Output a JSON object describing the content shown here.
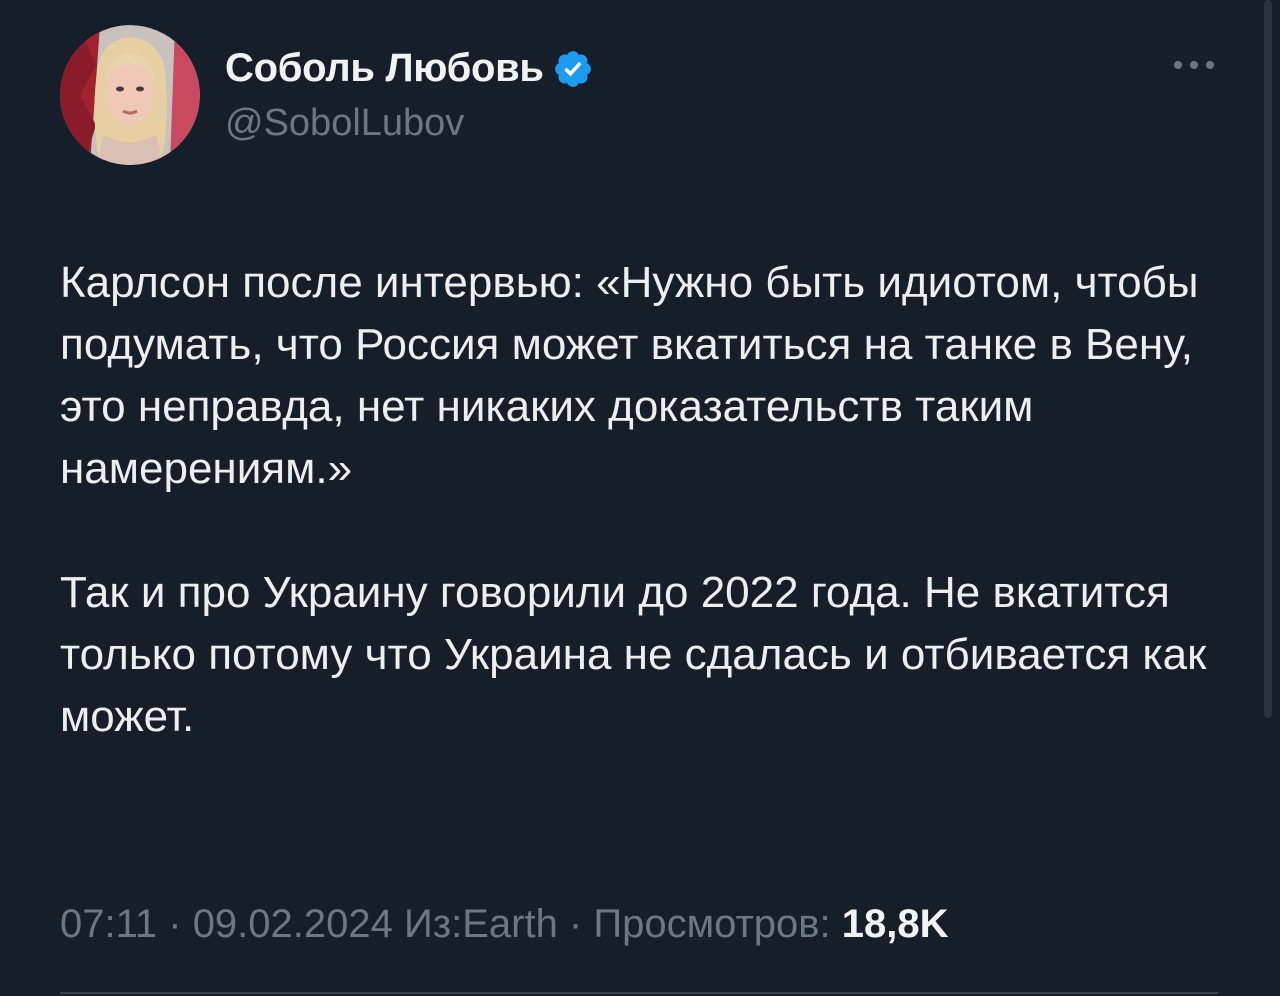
{
  "author": {
    "name": "Соболь Любовь",
    "handle": "@SobolLubov",
    "verified": true,
    "avatar_icon": "avatar-photo"
  },
  "tweet": {
    "paragraph1": "Карлсон после интервью: «Нужно быть идиотом, чтобы подумать, что Россия может вкатиться на танке в Вену, это неправда, нет никаких доказательств таким намерениям.»",
    "paragraph2": "Так и про Украину говорили до 2022 года. Не вкатится только потому что Украина не сдалась и отбивается как может."
  },
  "meta": {
    "time": "07:11",
    "sep1": " · ",
    "date": "09.02.2024",
    "source": " Из:Earth",
    "sep2": " · ",
    "views_label": "Просмотров: ",
    "views_count": "18,8K"
  },
  "colors": {
    "background": "#161e2a",
    "verified": "#1d9bf0",
    "secondary_text": "#6e7781"
  },
  "icons": {
    "verified": "verified-badge-icon",
    "more": "more-options-icon"
  }
}
